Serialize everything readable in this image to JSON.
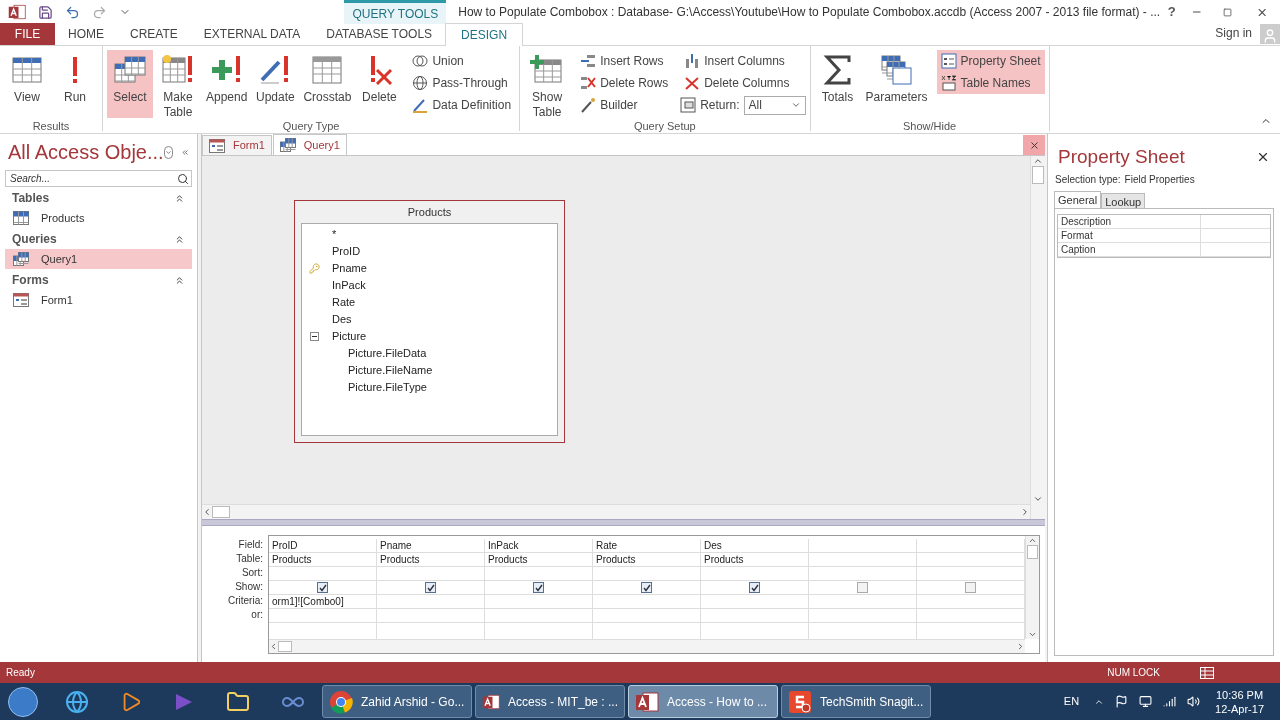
{
  "title_bar": {
    "context_label": "QUERY TOOLS",
    "title": "How to Populate Combobox : Database- G:\\Access\\Youtube\\How to Populate Combobox.accdb (Access 2007 - 2013 file format) - ...",
    "help": "?"
  },
  "ribbon_tabs": [
    {
      "label": "FILE",
      "kind": "file",
      "selected": false
    },
    {
      "label": "HOME",
      "kind": "normal",
      "selected": false
    },
    {
      "label": "CREATE",
      "kind": "normal",
      "selected": false
    },
    {
      "label": "EXTERNAL DATA",
      "kind": "normal",
      "selected": false
    },
    {
      "label": "DATABASE TOOLS",
      "kind": "normal",
      "selected": false
    },
    {
      "label": "DESIGN",
      "kind": "context",
      "selected": true
    }
  ],
  "sign_in": "Sign in",
  "ribbon_groups": [
    {
      "label": "Results",
      "items": [
        {
          "label": "View",
          "kind": "large",
          "selected": false
        },
        {
          "label": "Run",
          "kind": "large",
          "selected": false
        }
      ]
    },
    {
      "label": "Query Type",
      "items": [
        {
          "label": "Select",
          "kind": "large",
          "selected": true
        },
        {
          "label": "Make Table",
          "kind": "large",
          "selected": false
        },
        {
          "label": "Append",
          "kind": "large",
          "selected": false
        },
        {
          "label": "Update",
          "kind": "large",
          "selected": false
        },
        {
          "label": "Crosstab",
          "kind": "large",
          "selected": false
        },
        {
          "label": "Delete",
          "kind": "large",
          "selected": false
        },
        {
          "label": "Union",
          "kind": "small",
          "selected": false
        },
        {
          "label": "Pass-Through",
          "kind": "small",
          "selected": false
        },
        {
          "label": "Data Definition",
          "kind": "small",
          "selected": false
        }
      ]
    },
    {
      "label": "Query Setup",
      "items": [
        {
          "label": "Show Table",
          "kind": "large",
          "selected": false
        },
        {
          "label": "Insert Rows",
          "kind": "small",
          "selected": false
        },
        {
          "label": "Delete Rows",
          "kind": "small",
          "selected": false
        },
        {
          "label": "Builder",
          "kind": "small",
          "selected": false
        },
        {
          "label": "Insert Columns",
          "kind": "small",
          "selected": false
        },
        {
          "label": "Delete Columns",
          "kind": "small",
          "selected": false
        },
        {
          "label": "Return:",
          "kind": "dropdown",
          "value": "All"
        }
      ]
    },
    {
      "label": "Show/Hide",
      "items": [
        {
          "label": "Totals",
          "kind": "large",
          "selected": false
        },
        {
          "label": "Parameters",
          "kind": "large",
          "selected": false
        },
        {
          "label": "Property Sheet",
          "kind": "small",
          "selected": true
        },
        {
          "label": "Table Names",
          "kind": "small",
          "selected": true
        }
      ]
    }
  ],
  "nav_pane": {
    "title": "All Access Obje...",
    "search_placeholder": "Search...",
    "groups": [
      {
        "label": "Tables",
        "items": [
          {
            "label": "Products",
            "kind": "table",
            "selected": false
          }
        ]
      },
      {
        "label": "Queries",
        "items": [
          {
            "label": "Query1",
            "kind": "query",
            "selected": true
          }
        ]
      },
      {
        "label": "Forms",
        "items": [
          {
            "label": "Form1",
            "kind": "form",
            "selected": false
          }
        ]
      }
    ]
  },
  "doc_tabs": [
    {
      "label": "Form1",
      "kind": "form",
      "selected": false
    },
    {
      "label": "Query1",
      "kind": "query",
      "selected": true
    }
  ],
  "table_box": {
    "title": "Products",
    "fields": [
      {
        "label": "*",
        "primary_key": false
      },
      {
        "label": "ProID",
        "primary_key": false
      },
      {
        "label": "Pname",
        "primary_key": true
      },
      {
        "label": "InPack",
        "primary_key": false
      },
      {
        "label": "Rate",
        "primary_key": false
      },
      {
        "label": "Des",
        "primary_key": false
      },
      {
        "label": "Picture",
        "expanded": true,
        "children": [
          {
            "label": "Picture.FileData",
            "primary_key": false
          },
          {
            "label": "Picture.FileName",
            "primary_key": false
          },
          {
            "label": "Picture.FileType",
            "primary_key": false
          }
        ]
      }
    ]
  },
  "grid": {
    "row_labels": [
      "Field:",
      "Table:",
      "Sort:",
      "Show:",
      "Criteria:",
      "or:"
    ],
    "columns": [
      {
        "field": "ProID",
        "table": "Products",
        "show": true,
        "criteria": "orm1]![Combo0]"
      },
      {
        "field": "Pname",
        "table": "Products",
        "show": true
      },
      {
        "field": "InPack",
        "table": "Products",
        "show": true
      },
      {
        "field": "Rate",
        "table": "Products",
        "show": true
      },
      {
        "field": "Des",
        "table": "Products",
        "show": true
      },
      {
        "show": false
      },
      {
        "show": false
      }
    ]
  },
  "property_sheet": {
    "title": "Property Sheet",
    "selection_label": "Selection type:",
    "selection_value": "Field Properties",
    "tabs": [
      {
        "label": "General",
        "selected": true
      },
      {
        "label": "Lookup",
        "selected": false
      }
    ],
    "properties": [
      {
        "name": "Description"
      },
      {
        "name": "Format"
      },
      {
        "name": "Caption"
      }
    ]
  },
  "status_bar": {
    "left": "Ready",
    "right": "NUM LOCK"
  },
  "taskbar": {
    "tasks": [
      {
        "label": "Zahid Arshid - Go...",
        "kind": "chrome",
        "selected": false
      },
      {
        "label": "Access - MIT_be : ...",
        "kind": "access",
        "selected": false
      },
      {
        "label": "Access - How to ...",
        "kind": "access",
        "selected": true
      },
      {
        "label": "TechSmith Snagit...",
        "kind": "snagit",
        "selected": false
      }
    ],
    "language": "EN",
    "time": "10:36 PM",
    "date": "12-Apr-17"
  }
}
